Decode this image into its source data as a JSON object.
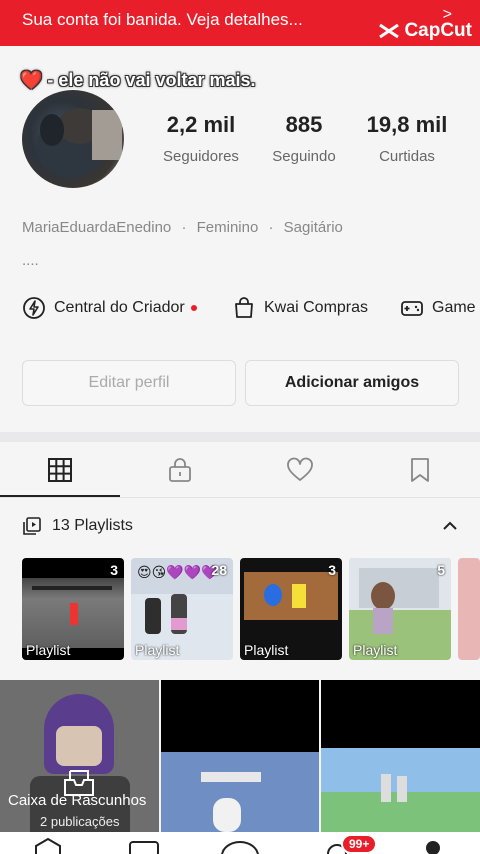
{
  "banner": {
    "text": "Sua conta foi banida. Veja detalhes...",
    "arrow": ">",
    "brand": "CapCut"
  },
  "profile": {
    "tagline": "❤️ - ele não vai voltar mais.",
    "stats": [
      {
        "value": "2,2 mil",
        "label": "Seguidores"
      },
      {
        "value": "885",
        "label": "Seguindo"
      },
      {
        "value": "19,8 mil",
        "label": "Curtidas"
      }
    ],
    "username": "MariaEduardaEnedino",
    "gender": "Feminino",
    "sign": "Sagitário",
    "separator": "·",
    "bio": "...."
  },
  "services": [
    {
      "label": "Central do Criador",
      "icon": "bolt-icon",
      "has_dot": true
    },
    {
      "label": "Kwai Compras",
      "icon": "shopping-bag-icon"
    },
    {
      "label": "Game",
      "icon": "gamepad-icon"
    }
  ],
  "actions": {
    "edit": "Editar perfil",
    "add": "Adicionar amigos"
  },
  "tabs": [
    "grid-icon",
    "lock-icon",
    "heart-icon",
    "bookmark-icon"
  ],
  "playlists": {
    "header": "13 Playlists",
    "items": [
      {
        "count": "3",
        "label": "Playlist"
      },
      {
        "count": "28",
        "label": "Playlist"
      },
      {
        "count": "3",
        "label": "Playlist"
      },
      {
        "count": "5",
        "label": "Playlist"
      }
    ]
  },
  "grid": {
    "drafts_title": "Caixa de Rascunhos",
    "drafts_sub": "2 publicações"
  },
  "nav": {
    "badge": "99+"
  },
  "colors": {
    "brand_red": "#e81f2a",
    "background": "#f5f5f6"
  }
}
